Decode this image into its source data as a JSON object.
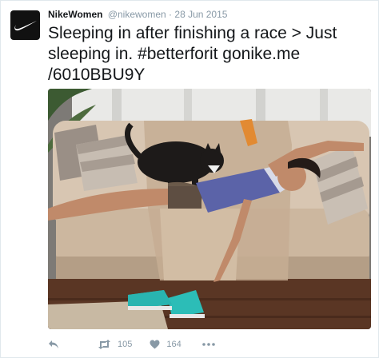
{
  "tweet": {
    "author_name": "NikeWomen",
    "handle": "@nikewomen",
    "separator": "·",
    "date": "28 Jun 2015",
    "text": "Sleeping in after finishing a race > Just sleeping in. #betterforit gonike.me /6010BBU9Y",
    "avatar_icon": "nike-swoosh-icon",
    "photo_icon": "photo-woman-sleeping-on-couch-with-cat"
  },
  "actions": {
    "reply_icon": "reply-icon",
    "retweet_icon": "retweet-icon",
    "retweet_count": "105",
    "like_icon": "heart-icon",
    "like_count": "164",
    "more_icon": "more-icon"
  },
  "colors": {
    "accent_gray": "#8899a6",
    "text": "#14171a",
    "border": "#e1e8ed"
  }
}
